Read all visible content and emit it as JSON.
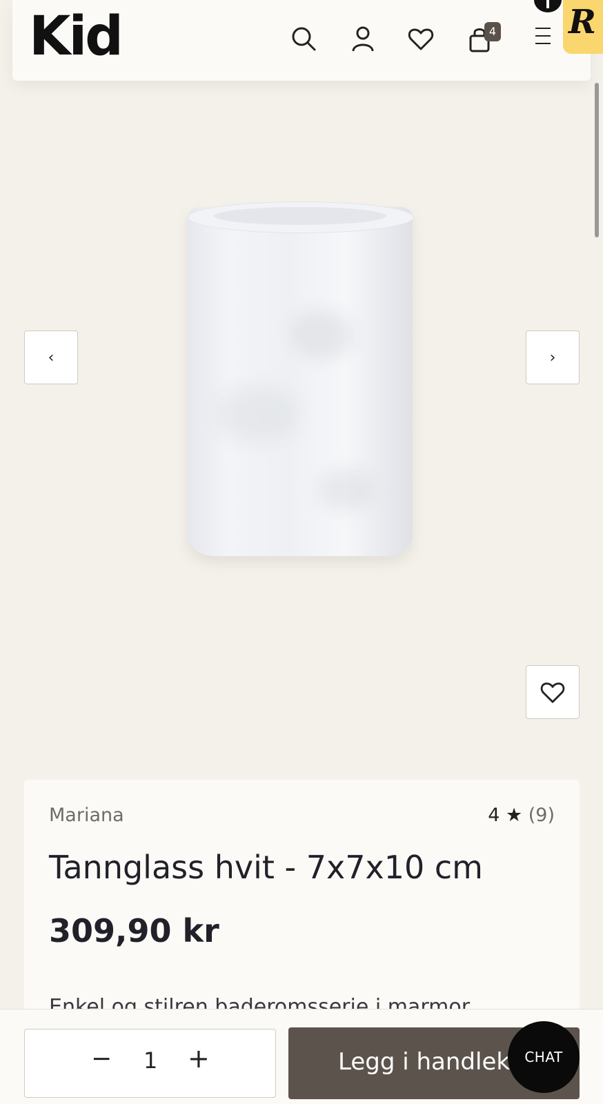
{
  "header": {
    "logo": "Kid",
    "cart_count": "4",
    "icons": [
      "search-icon",
      "account-icon",
      "heart-icon",
      "cart-icon",
      "menu-icon"
    ]
  },
  "reward_badge": {
    "letter": "R",
    "accent": "#fad66e"
  },
  "gallery": {
    "prev_label": "‹",
    "next_label": "›",
    "favorite_icon": "heart-icon"
  },
  "product": {
    "brand": "Mariana",
    "rating": "4 ★",
    "rating_count": "(9)",
    "title": "Tannglass hvit - 7x7x10 cm",
    "price": "309,90 kr",
    "description": "Enkel og stilren baderomsserie i marmor."
  },
  "purchase": {
    "quantity": "1",
    "minus_label": "−",
    "plus_label": "+",
    "add_to_cart_label": "Legg i handlekurv",
    "button_color": "#5c544c"
  },
  "chat": {
    "label": "CHAT"
  }
}
